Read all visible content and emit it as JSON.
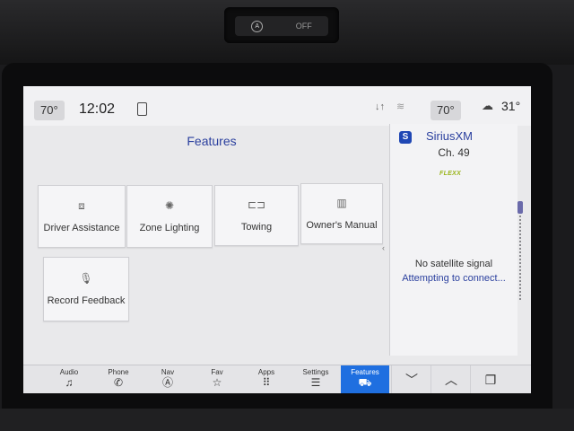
{
  "climate": {
    "auto_label": "A",
    "off_label": "OFF"
  },
  "status_bar": {
    "left_temp": "70°",
    "clock": "12:02",
    "data_indicator": "↓↑",
    "right_temp": "70°",
    "outside_temp": "31°"
  },
  "features": {
    "title": "Features",
    "tiles": [
      {
        "label": "Driver Assistance",
        "icon": "driver-assist-icon"
      },
      {
        "label": "Zone Lighting",
        "icon": "zone-lighting-icon"
      },
      {
        "label": "Towing",
        "icon": "trailer-icon"
      },
      {
        "label": "Owner's Manual",
        "icon": "book-icon"
      },
      {
        "label": "Record Feedback",
        "icon": "microphone-icon"
      }
    ]
  },
  "radio": {
    "logo": "S",
    "source": "SiriusXM",
    "channel": "Ch. 49",
    "badge": "FLEXX",
    "message": "No satellite signal",
    "status": "Attempting to connect..."
  },
  "nav": {
    "items": [
      {
        "label": "Audio",
        "icon": "music-note-icon"
      },
      {
        "label": "Phone",
        "icon": "phone-icon"
      },
      {
        "label": "Nav",
        "icon": "navigation-icon"
      },
      {
        "label": "Fav",
        "icon": "star-icon"
      },
      {
        "label": "Apps",
        "icon": "apps-grid-icon"
      },
      {
        "label": "Settings",
        "icon": "sliders-icon"
      },
      {
        "label": "Features",
        "icon": "truck-icon"
      }
    ],
    "active": "Features",
    "active_color": "#1f6fe0"
  },
  "colors": {
    "accent_text": "#2a3f9e",
    "screen_bg": "#e9e9eb"
  }
}
